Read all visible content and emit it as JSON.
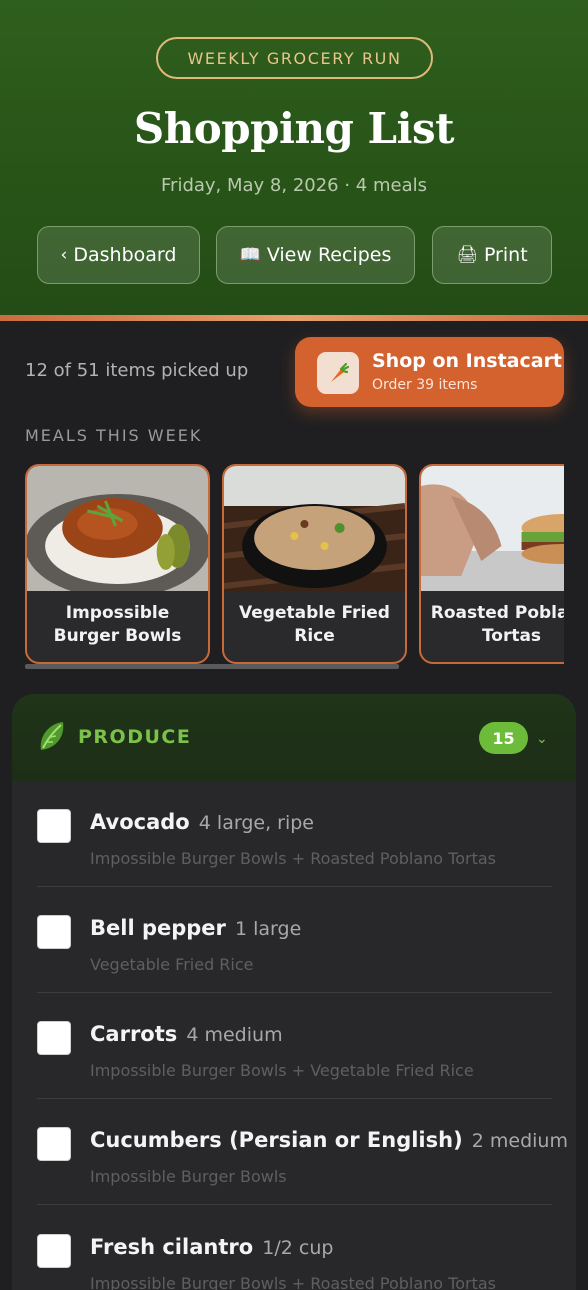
{
  "header": {
    "badge": "WEEKLY GROCERY RUN",
    "title": "Shopping List",
    "subtitle": "Friday, May 8, 2026 · 4 meals",
    "buttons": [
      {
        "icon": "‹",
        "label": "Dashboard"
      },
      {
        "icon": "📖",
        "label": "View Recipes"
      },
      {
        "icon": "🖨",
        "label": "Print"
      }
    ]
  },
  "progress": {
    "text": "12 of 51 items picked up"
  },
  "instacart": {
    "title": "Shop on Instacart",
    "subtitle": "Order 39 items",
    "icon": "carrot-icon"
  },
  "meals_label": "MEALS THIS WEEK",
  "meals": [
    {
      "name": "Impossible Burger Bowls"
    },
    {
      "name": "Vegetable Fried Rice"
    },
    {
      "name": "Roasted Poblano Tortas"
    }
  ],
  "section": {
    "label": "PRODUCE",
    "icon": "lettuce-icon",
    "count": "15",
    "chevron": "⌄",
    "items": [
      {
        "name": "Avocado",
        "qty": "4 large, ripe",
        "meals": "Impossible Burger Bowls + Roasted Poblano Tortas"
      },
      {
        "name": "Bell pepper",
        "qty": "1 large",
        "meals": "Vegetable Fried Rice"
      },
      {
        "name": "Carrots",
        "qty": "4 medium",
        "meals": "Impossible Burger Bowls + Vegetable Fried Rice"
      },
      {
        "name": "Cucumbers (Persian or English)",
        "qty": "2 medium",
        "meals": "Impossible Burger Bowls"
      },
      {
        "name": "Fresh cilantro",
        "qty": "1/2 cup",
        "meals": "Impossible Burger Bowls + Roasted Poblano Tortas"
      }
    ]
  },
  "colors": {
    "header_green": "#2f5f1d",
    "accent_copper": "#d3622e",
    "produce_green": "#7cc24a",
    "background": "#1f1f21"
  }
}
